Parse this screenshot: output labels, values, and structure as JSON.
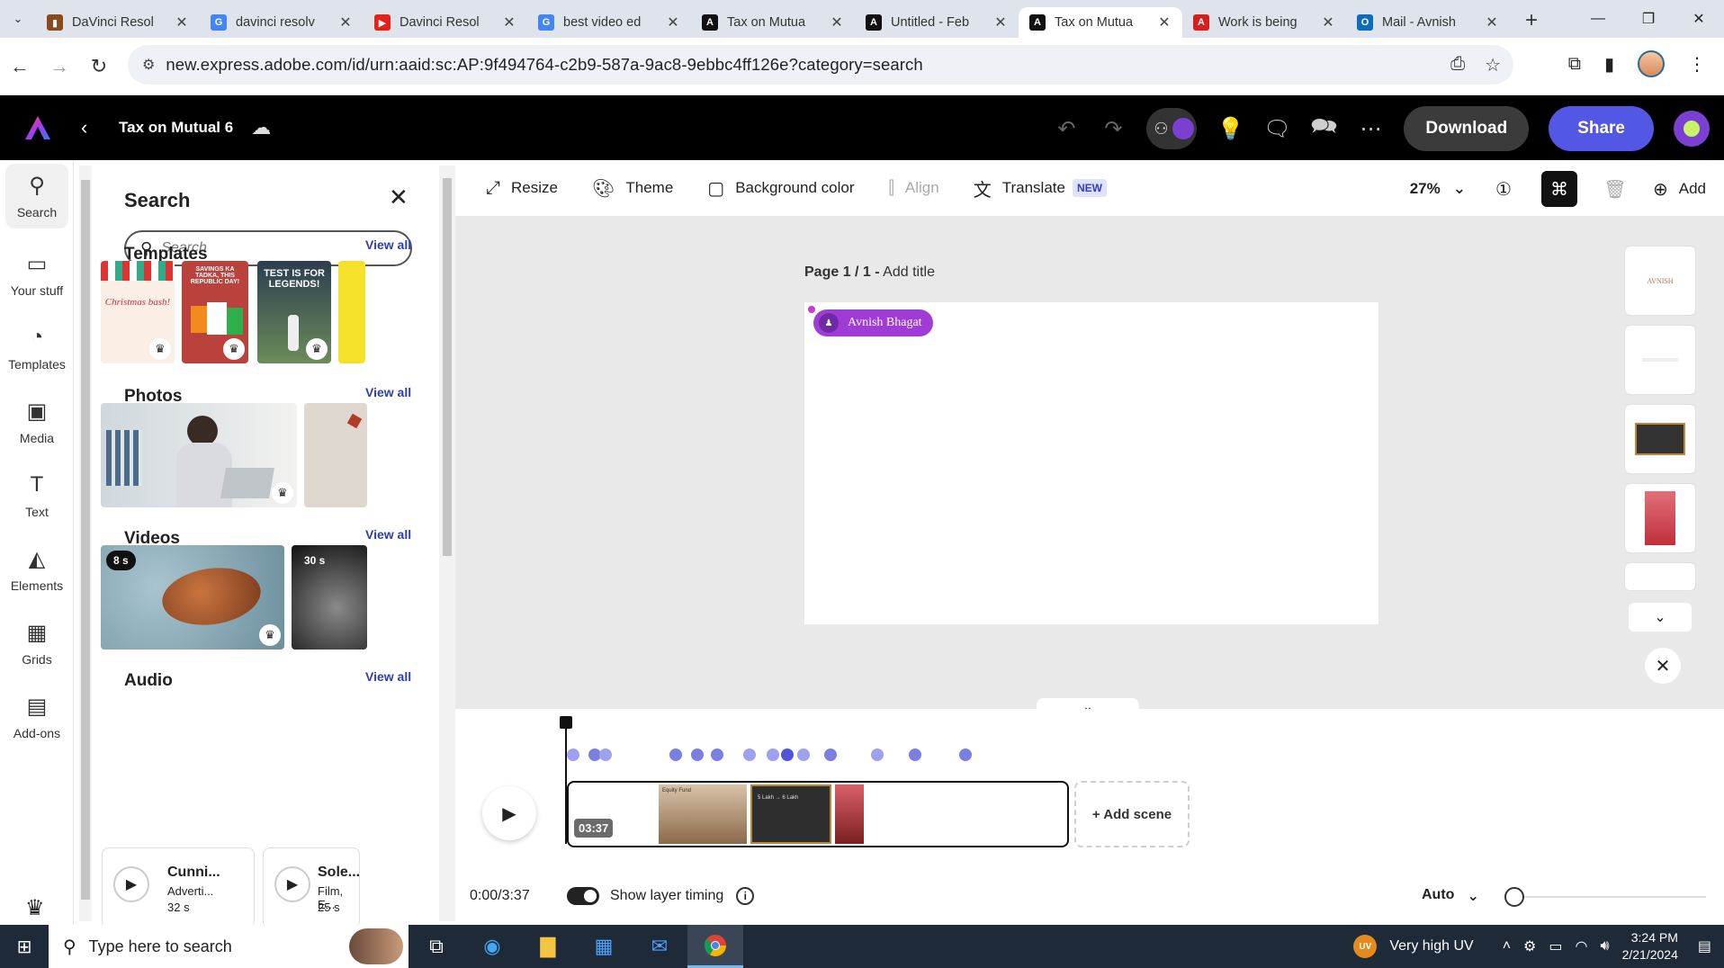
{
  "browser": {
    "tabs": [
      {
        "title": "DaVinci Resol",
        "favicon": "davinci-icon",
        "color": "#8a4b1c"
      },
      {
        "title": "davinci resolv",
        "favicon": "google-icon",
        "color": "#4285f4"
      },
      {
        "title": "Davinci Resol",
        "favicon": "youtube-icon",
        "color": "#e62117"
      },
      {
        "title": "best video ed",
        "favicon": "google-icon",
        "color": "#4285f4"
      },
      {
        "title": "Tax on Mutua",
        "favicon": "adobe-express-icon",
        "color": "#111"
      },
      {
        "title": "Untitled - Feb",
        "favicon": "adobe-express-icon",
        "color": "#111"
      },
      {
        "title": "Tax on Mutua",
        "favicon": "adobe-express-icon",
        "color": "#111",
        "active": true
      },
      {
        "title": "Work is being",
        "favicon": "adobe-icon",
        "color": "#d71e1e"
      },
      {
        "title": "Mail - Avnish",
        "favicon": "outlook-icon",
        "color": "#0f6cbd"
      }
    ],
    "url": "new.express.adobe.com/id/urn:aaid:sc:AP:9f494764-c2b9-587a-9ac8-9ebbc4ff126e?category=search"
  },
  "app": {
    "doc_title": "Tax on Mutual 6",
    "download_label": "Download",
    "share_label": "Share",
    "accent": "#5258e4"
  },
  "rail": {
    "items": [
      {
        "label": "Search",
        "icon": "search-icon"
      },
      {
        "label": "Your stuff",
        "icon": "folder-icon"
      },
      {
        "label": "Templates",
        "icon": "templates-icon"
      },
      {
        "label": "Media",
        "icon": "media-icon"
      },
      {
        "label": "Text",
        "icon": "text-icon"
      },
      {
        "label": "Elements",
        "icon": "elements-icon"
      },
      {
        "label": "Grids",
        "icon": "grids-icon"
      },
      {
        "label": "Add-ons",
        "icon": "addons-icon"
      }
    ]
  },
  "panel": {
    "title": "Search",
    "search_placeholder": "Search",
    "view_all": "View all",
    "templates_title": "Templates",
    "photos_title": "Photos",
    "videos_title": "Videos",
    "audio_title": "Audio",
    "templates": [
      {
        "text": "Christmas bash!"
      },
      {
        "text": "SAVINGS KA TADKA, THIS REPUBLIC DAY!"
      },
      {
        "text": "TEST IS FOR LEGENDS!"
      }
    ],
    "videos": [
      {
        "badge": "8 s"
      },
      {
        "badge": "30 s"
      }
    ],
    "audio": [
      {
        "name": "Cunni...",
        "category": "Adverti...",
        "duration": "32 s"
      },
      {
        "name": "Sole...",
        "category": "Film, E...",
        "duration": "25 s"
      }
    ]
  },
  "toolbar": {
    "resize": "Resize",
    "theme": "Theme",
    "background_color": "Background color",
    "align": "Align",
    "translate": "Translate",
    "new_badge": "NEW",
    "zoom": "27%",
    "add": "Add"
  },
  "canvas": {
    "page_label": "Page 1 / 1 -",
    "add_title": "Add title",
    "name_chip": "Avnish Bhagat",
    "page_thumb_1": "AVNISH"
  },
  "timeline": {
    "duration_chip": "03:37",
    "add_scene": "+ Add scene",
    "time": "0:00/3:37",
    "show_layer_timing": "Show layer timing",
    "auto": "Auto",
    "scene_1_text": "Equity Fund",
    "scene_2_text": "5 Lakh → 6 Lakh"
  },
  "taskbar": {
    "search_placeholder": "Type here to search",
    "weather": "Very high UV",
    "uv": "UV",
    "time": "3:24 PM",
    "date": "2/21/2024"
  }
}
